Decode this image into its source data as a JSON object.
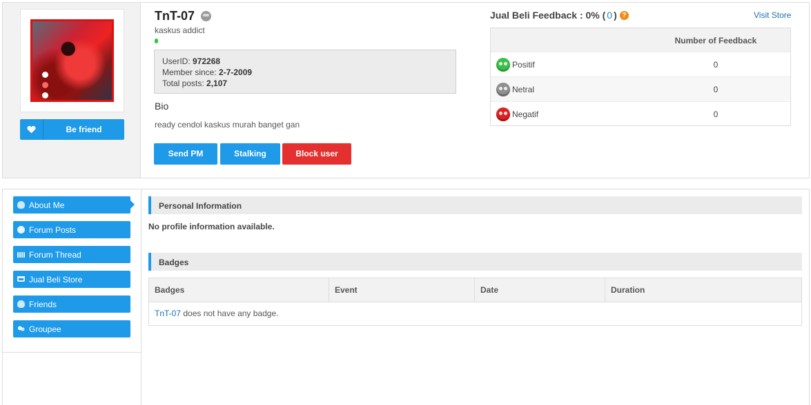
{
  "profile": {
    "username": "TnT-07",
    "title": "kaskus addict",
    "user_id_label": "UserID:",
    "user_id": "972268",
    "member_since_label": "Member since:",
    "member_since": "2-7-2009",
    "total_posts_label": "Total posts:",
    "total_posts": "2,107",
    "bio_label": "Bio",
    "bio": "ready cendol kaskus murah banget gan",
    "be_friend_label": "Be friend",
    "icons": {
      "heart": "heart-icon",
      "status": "offline-status-icon"
    }
  },
  "actions": {
    "send_pm": "Send PM",
    "stalking": "Stalking",
    "block_user": "Block user"
  },
  "feedback": {
    "title_prefix": "Jual Beli Feedback : 0% (",
    "count": "0",
    "title_suffix": ")",
    "help_glyph": "?",
    "visit_store": "Visit Store",
    "column_header": "Number of Feedback",
    "rows": [
      {
        "label": "Positif",
        "value": "0",
        "color": "#3cbf4a"
      },
      {
        "label": "Netral",
        "value": "0",
        "color": "#8f8f8f"
      },
      {
        "label": "Negatif",
        "value": "0",
        "color": "#dd2020"
      }
    ]
  },
  "sidebar": {
    "items": [
      {
        "label": "About Me",
        "icon": "person-icon",
        "active": true
      },
      {
        "label": "Forum Posts",
        "icon": "chat-bubble-icon"
      },
      {
        "label": "Forum Thread",
        "icon": "film-icon"
      },
      {
        "label": "Jual Beli Store",
        "icon": "cart-icon"
      },
      {
        "label": "Friends",
        "icon": "person-icon"
      },
      {
        "label": "Groupee",
        "icon": "people-icon"
      }
    ]
  },
  "personal": {
    "heading": "Personal Information",
    "empty_text": "No profile information available."
  },
  "badges": {
    "heading": "Badges",
    "columns": [
      "Badges",
      "Event",
      "Date",
      "Duration"
    ],
    "empty_user": "TnT-07",
    "empty_text": " does not have any badge."
  },
  "colors": {
    "accent": "#1e9ae8",
    "danger": "#e53030",
    "link": "#1e6fb0"
  }
}
